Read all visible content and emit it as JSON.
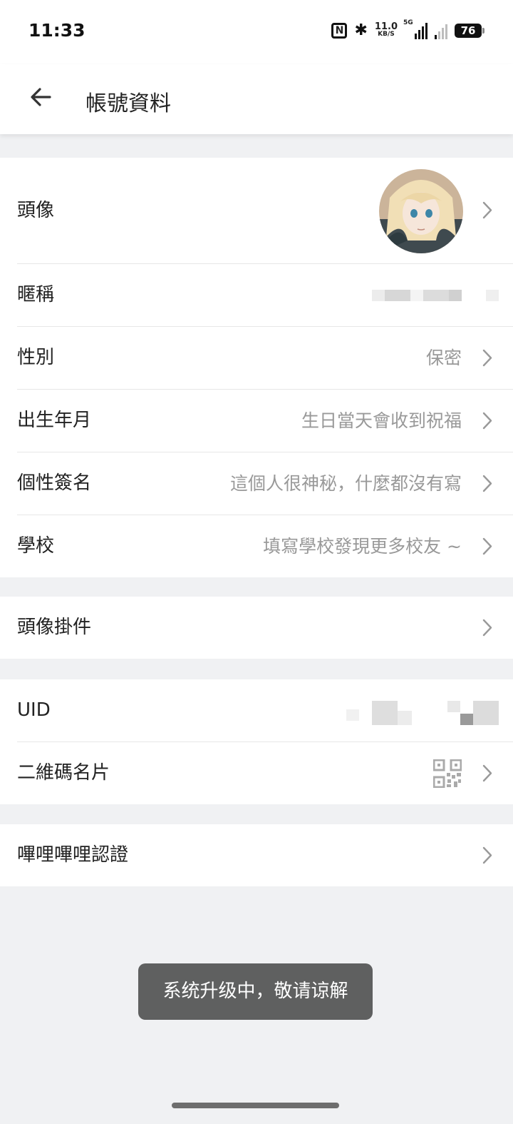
{
  "status_bar": {
    "time": "11:33",
    "net_speed_value": "11.0",
    "net_speed_unit": "KB/S",
    "network_type": "5G",
    "battery": "76"
  },
  "header": {
    "title": "帳號資料",
    "back_icon": "arrow-left-icon"
  },
  "sections": {
    "profile": {
      "avatar_label": "頭像",
      "nickname_label": "暱稱",
      "gender_label": "性別",
      "gender_value": "保密",
      "birthday_label": "出生年月",
      "birthday_value": "生日當天會收到祝福",
      "signature_label": "個性簽名",
      "signature_value": "這個人很神秘，什麼都沒有寫",
      "school_label": "學校",
      "school_value": "填寫學校發現更多校友 ~"
    },
    "pendant": {
      "label": "頭像掛件"
    },
    "account": {
      "uid_label": "UID",
      "qrcode_label": "二維碼名片"
    },
    "verify": {
      "label": "嗶哩嗶哩認證"
    }
  },
  "toast": {
    "message": "系统升级中，敬请谅解"
  },
  "colors": {
    "background": "#f0f1f3",
    "secondary_text": "#999999",
    "toast_bg": "#5f6060"
  }
}
